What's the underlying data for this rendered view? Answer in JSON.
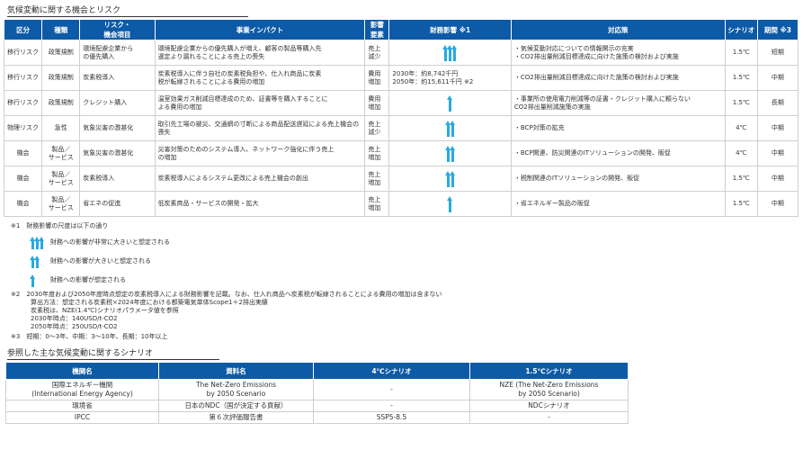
{
  "section1_title": "気候変動に関する機会とリスク",
  "risk_table": {
    "headers": [
      "区分",
      "種類",
      "リスク・\n機会項目",
      "事業インパクト",
      "影響\n要素",
      "財務影響 ※1",
      "対応策",
      "シナリオ",
      "期間 ※3"
    ],
    "rows": [
      {
        "category": "移行リスク",
        "type": "政策規制",
        "item": "環境配慮企業から\nの優先購入",
        "impact": "環境配慮企業からの優先購入が増え、顧客の製品等購入先\n選定より漏れることによる売上の喪失",
        "element": "売上\n減少",
        "finance_arrows": 3,
        "finance_text": "",
        "measures": "・気候変動対応についての情報開示の充実\n・CO2排出量削減目標達成に向けた施策の検討および実施",
        "scenario": "1.5℃",
        "period": "短期"
      },
      {
        "category": "移行リスク",
        "type": "政策規制",
        "item": "炭素税導入",
        "impact": "炭素税導入に伴う自社の炭素税負担や、仕入れ商品に炭素\n税が転嫁されることによる費用の増加",
        "element": "費用\n増加",
        "finance_arrows": 0,
        "finance_text": "2030年：約8,742千円\n2050年：約15,611千円 ※2",
        "measures": "・CO2排出量削減目標達成に向けた施策の検討および実施",
        "scenario": "1.5℃",
        "period": "中期"
      },
      {
        "category": "移行リスク",
        "type": "政策規制",
        "item": "クレジット購入",
        "impact": "温室効果ガス削減目標達成のため、証書等を購入することに\nよる費用の増加",
        "element": "費用\n増加",
        "finance_arrows": 1,
        "finance_text": "",
        "measures": "・事業所の使用電力削減等の証書・クレジット購入に頼らない\nCO2排出量削減施策の実施",
        "scenario": "1.5℃",
        "period": "長期"
      },
      {
        "category": "物理リスク",
        "type": "急性",
        "item": "気象災害の激甚化",
        "impact": "取引先工場の被災、交通網の寸断による商品配送遅延による売上機会の喪失",
        "element": "売上\n減少",
        "finance_arrows": 2,
        "finance_text": "",
        "measures": "・BCP対策の拡充",
        "scenario": "4℃",
        "period": "中期"
      },
      {
        "category": "機会",
        "type": "製品／\nサービス",
        "item": "気象災害の激甚化",
        "impact": "災害対策のためのシステム導入、ネットワーク強化に伴う売上\nの増加",
        "element": "売上\n増加",
        "finance_arrows": 2,
        "finance_text": "",
        "measures": "・BCP関連、防災関連のITソリューションの開発、販促",
        "scenario": "4℃",
        "period": "中期"
      },
      {
        "category": "機会",
        "type": "製品／\nサービス",
        "item": "炭素税導入",
        "impact": "炭素税導入によるシステム更改による売上機会の創出",
        "element": "売上\n増加",
        "finance_arrows": 2,
        "finance_text": "",
        "measures": "・税制関連のITソリューションの開発、販促",
        "scenario": "1.5℃",
        "period": "中期"
      },
      {
        "category": "機会",
        "type": "製品／\nサービス",
        "item": "省エネの促進",
        "impact": "低炭素商品・サービスの開発・拡大",
        "element": "売上\n増加",
        "finance_arrows": 1,
        "finance_text": "",
        "measures": "・省エネルギー製品の販促",
        "scenario": "1.5℃",
        "period": "中期"
      }
    ]
  },
  "notes": {
    "n1": "※1　財務影響の尺度は以下の通り",
    "legend": [
      {
        "arrows": 3,
        "text": "財務への影響が非常に大きいと想定される"
      },
      {
        "arrows": 2,
        "text": "財務への影響が大きいと想定される"
      },
      {
        "arrows": 1,
        "text": "財務への影響が想定される"
      }
    ],
    "n2_lines": [
      "※2　2030年度および2050年度時点想定の炭素税導入による財務影響を記載。なお、仕入れ商品へ炭素税が転嫁されることによる費用の増加は含まない",
      "算出方法：想定される炭素税×2024年度における都築電気単体Scope1＋2排出実績",
      "炭素税は、NZE(1.4℃)シナリオパラメータ値を参照",
      "2030年時点：140USD/t-CO2",
      "2050年時点：250USD/t-CO2"
    ],
    "n3": "※3　短期：0～3年、中期：3～10年、長期：10年以上"
  },
  "section2_title": "参照した主な気候変動に関するシナリオ",
  "scenario_table": {
    "headers": [
      "機関名",
      "資料名",
      "4℃シナリオ",
      "1.5℃シナリオ"
    ],
    "rows": [
      [
        "国際エネルギー機関\n(International Energy Agency)",
        "The Net-Zero Emissions\nby 2050 Scenario",
        "-",
        "NZE (The Net-Zero Emissions\nby 2050 Scenario)"
      ],
      [
        "環境省",
        "日本のNDC（国が決定する貢献）",
        "-",
        "NDCシナリオ"
      ],
      [
        "IPCC",
        "第６次評価報告書",
        "SSP5-8.5",
        "-"
      ]
    ]
  },
  "colors": {
    "header_bg": "#0d5aa7",
    "arrow": "#29a9e0"
  }
}
